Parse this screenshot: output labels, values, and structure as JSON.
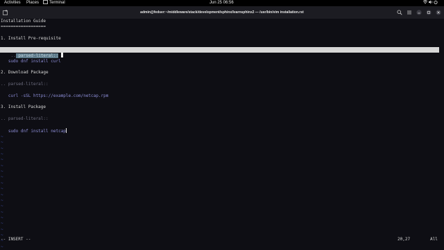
{
  "topbar": {
    "activities": "Activities",
    "places": "Places",
    "app": "Terminal",
    "datetime": "Jun 25  06:56"
  },
  "window": {
    "title": "admin@fedser:~/middleware/stack/development/sphinx/learnsphinx2 — /usr/bin/vim installation.rst"
  },
  "editor": {
    "lines": {
      "l1": "Installation Guide",
      "l2": "==================",
      "l4": "1. Install Pre-requisite",
      "l6_marker": "..",
      "l6_directive": "parsed-literal::",
      "l8": "   sudo dnf install curl",
      "l10": "2. Download Package",
      "l12": ".. parsed-literal::",
      "l14": "   curl -sSL https://example.com/netcap.rpm",
      "l16": "3. Install Package",
      "l18": ".. parsed-literal::",
      "l20": "   sudo dnf install netcap"
    },
    "empty_line_marker": "~"
  },
  "status": {
    "mode": "-- INSERT --",
    "position": "20,27",
    "scroll": "All"
  },
  "colors": {
    "background": "#0e0e14",
    "text": "#d6d6d6",
    "comment": "#6d6d7f",
    "literal": "#8d8ed8",
    "tilde": "#3a4a9a",
    "cursorline": "#d6d6d6"
  },
  "icons": {
    "network": "network-icon",
    "volume": "volume-icon",
    "power": "power-icon",
    "new_tab": "new-tab-icon",
    "search": "search-icon",
    "menu": "hamburger-menu-icon",
    "minimize": "minimize-icon",
    "maximize": "maximize-icon",
    "close": "close-icon"
  }
}
